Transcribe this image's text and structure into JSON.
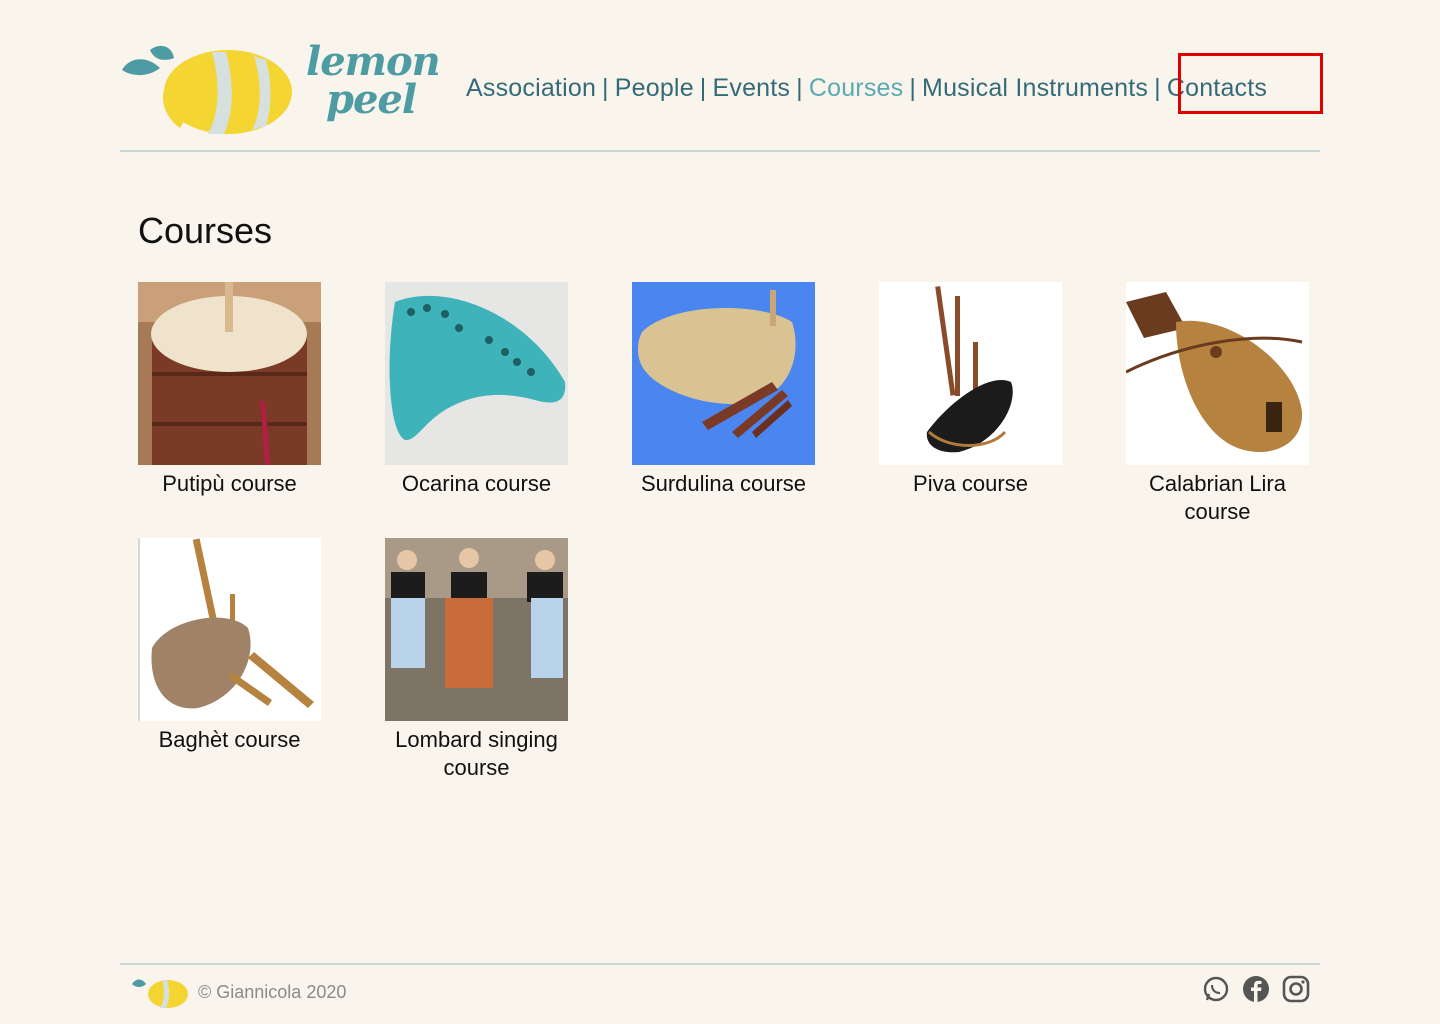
{
  "brand": {
    "line1": "lemon",
    "line2": "peel"
  },
  "nav": {
    "items": [
      "Association",
      "People",
      "Events",
      "Courses",
      "Musical Instruments",
      "Contacts"
    ],
    "separator": "|",
    "active": "Courses"
  },
  "page": {
    "title": "Courses"
  },
  "courses": [
    {
      "label": "Putipù course"
    },
    {
      "label": "Ocarina course"
    },
    {
      "label": "Surdulina course"
    },
    {
      "label": "Piva course"
    },
    {
      "label": "Calabrian Lira course"
    },
    {
      "label": "Baghèt course"
    },
    {
      "label": "Lombard singing course"
    }
  ],
  "footer": {
    "copyright": "© Giannicola 2020",
    "social": [
      "whatsapp-icon",
      "facebook-icon",
      "instagram-icon"
    ]
  },
  "colors": {
    "background": "#f9f4ec",
    "nav": "#356b79",
    "active": "#5aa9b3",
    "highlight": "#e00000"
  }
}
